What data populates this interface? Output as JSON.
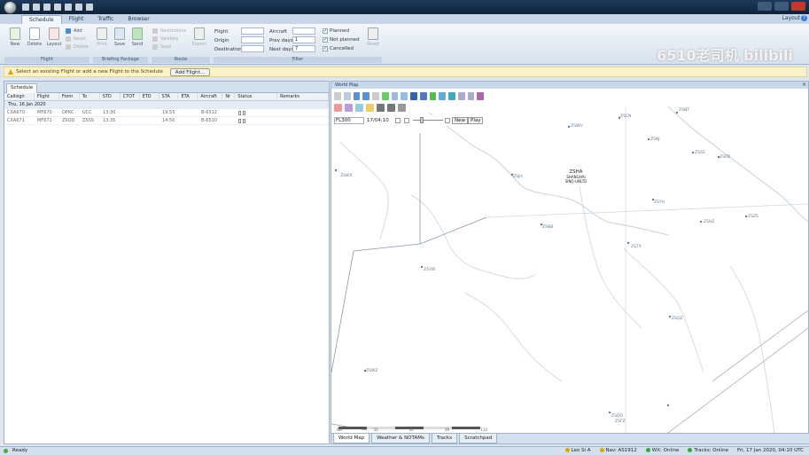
{
  "ribbon": {
    "tabs": [
      "Schedule",
      "Flight",
      "Traffic",
      "Browser"
    ],
    "active_tab": "Schedule",
    "layout_label": "Layout",
    "flight_group": {
      "label": "Flight",
      "buttons": [
        "New",
        "Delete",
        "Layout"
      ],
      "small": [
        "Add",
        "Reset",
        "Delete"
      ]
    },
    "briefing_group": {
      "label": "Briefing Package",
      "buttons": [
        "Print",
        "Save",
        "Send"
      ]
    },
    "route_group": {
      "label": "Route",
      "small": [
        "Restrictions",
        "Validate",
        "Save"
      ],
      "export_label": "Export"
    },
    "filter_group": {
      "label": "Filter",
      "flight_label": "Flight",
      "origin_label": "Origin",
      "destination_label": "Destination",
      "aircraft_label": "Aircraft",
      "prev_days_label": "Prev days",
      "prev_days_value": "1",
      "next_days_label": "Next days",
      "next_days_value": "7",
      "planned_label": "Planned",
      "not_planned_label": "Not planned",
      "cancelled_label": "Cancelled",
      "reset_label": "Reset"
    }
  },
  "infobar": {
    "message": "Select an existing Flight or add a new Flight to the Schedule",
    "button": "Add Flight..."
  },
  "schedule": {
    "tab": "Schedule",
    "columns": [
      "Callsign",
      "Flight",
      "From",
      "To",
      "STD",
      "CTOT",
      "ETD",
      "STA",
      "ETA",
      "Aircraft",
      "Nr",
      "Status",
      "Remarks"
    ],
    "date_group": "Thu, 16 Jan 2020",
    "rows": [
      {
        "callsign": "CXA670",
        "flight": "MF670",
        "from": "OPKC",
        "to": "UCC",
        "std": "13:30",
        "sta": "19:55",
        "aircraft": "B-6312"
      },
      {
        "callsign": "CXA671",
        "flight": "MF671",
        "from": "ZSQD",
        "to": "ZSSS",
        "std": "13:35",
        "sta": "14:50",
        "aircraft": "B-6510"
      }
    ]
  },
  "map": {
    "title": "World Map",
    "level": "FL300",
    "time": "17/04:10",
    "new_label": "New",
    "play_label": "Play",
    "scale_labels": [
      "NM",
      "50",
      "60",
      "90",
      "110"
    ],
    "labels": [
      {
        "code": "ZSNT"
      },
      {
        "code": "ZSCN"
      },
      {
        "code": "ZSWU"
      },
      {
        "code": "ZSNJ"
      },
      {
        "code": "ZSSS"
      },
      {
        "code": "ZSPD"
      },
      {
        "code": "ZSJH"
      },
      {
        "code": "ZSYH"
      },
      {
        "code": "ZSHZ"
      },
      {
        "code": "ZSNB"
      },
      {
        "code": "ZSZS"
      },
      {
        "code": "ZSTX"
      },
      {
        "code": "ZSYW"
      },
      {
        "code": "ZSQZ"
      },
      {
        "code": "ZSWZ"
      },
      {
        "code": "ZSOO"
      },
      {
        "code": "ZSFZ"
      },
      {
        "code": "ZSWX"
      }
    ],
    "fir_label": [
      "ZSHA",
      "SHANGHAI",
      "SINO-UNLTD"
    ],
    "bottom_tabs": [
      "World Map",
      "Weather & NOTAMs",
      "Tracks",
      "Scratchpad"
    ],
    "active_bottom_tab": "World Map"
  },
  "statusbar": {
    "ready": "Ready",
    "user": "Leo Si A",
    "nav": "Nav: AS1912",
    "wx": "WX: Online",
    "tracks": "Tracks: Online",
    "datetime": "Fri, 17 Jan 2020, 04:10 UTC"
  },
  "watermark": "6510老司机 bilibili"
}
